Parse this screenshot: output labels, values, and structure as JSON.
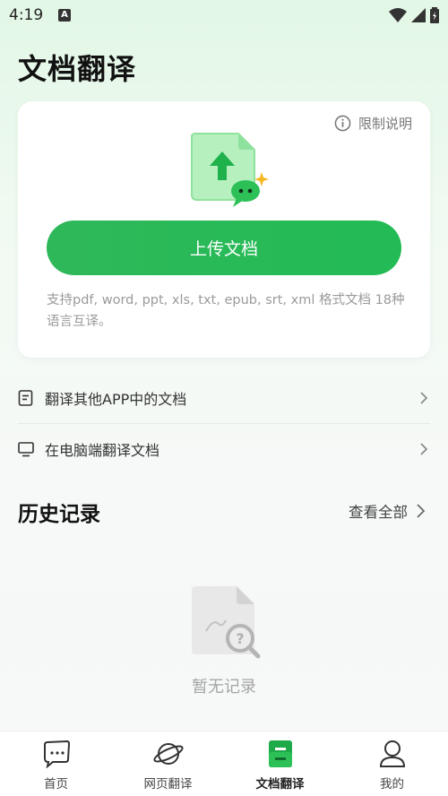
{
  "status_bar": {
    "time": "4:19",
    "notification_badge": "A"
  },
  "header": {
    "title": "文档翻译"
  },
  "upload_card": {
    "limit_label": "限制说明",
    "upload_button_label": "上传文档",
    "support_text": "支持pdf, word, ppt, xls, txt, epub, srt, xml 格式文档 18种语言互译。"
  },
  "links": [
    {
      "label": "翻译其他APP中的文档",
      "icon": "document-icon"
    },
    {
      "label": "在电脑端翻译文档",
      "icon": "monitor-icon"
    }
  ],
  "history": {
    "title": "历史记录",
    "view_all_label": "查看全部",
    "empty_text": "暂无记录"
  },
  "tab_bar": {
    "tabs": [
      {
        "label": "首页",
        "icon": "chat-home-icon",
        "active": false
      },
      {
        "label": "网页翻译",
        "icon": "planet-icon",
        "active": false
      },
      {
        "label": "文档翻译",
        "icon": "document-translate-icon",
        "active": true
      },
      {
        "label": "我的",
        "icon": "profile-icon",
        "active": false
      }
    ]
  },
  "colors": {
    "accent": "#22bb55",
    "background_top": "#e2f7e6",
    "muted_text": "#9a9a9a"
  }
}
